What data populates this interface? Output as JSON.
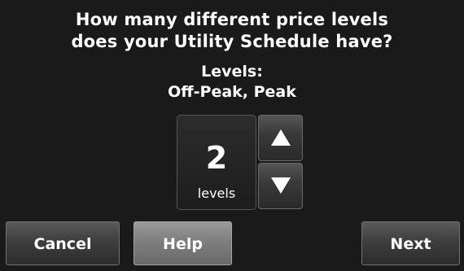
{
  "prompt": {
    "line1": "How many different price levels",
    "line2": "does your Utility Schedule have?"
  },
  "levels": {
    "heading": "Levels:",
    "values": "Off-Peak, Peak"
  },
  "selector": {
    "value": "2",
    "unit": "levels"
  },
  "buttons": {
    "cancel": "Cancel",
    "help": "Help",
    "next": "Next"
  },
  "icons": {
    "up": "up-arrow-icon",
    "down": "down-arrow-icon"
  },
  "colors": {
    "background": "#1a1a1a",
    "text": "#ffffff"
  }
}
